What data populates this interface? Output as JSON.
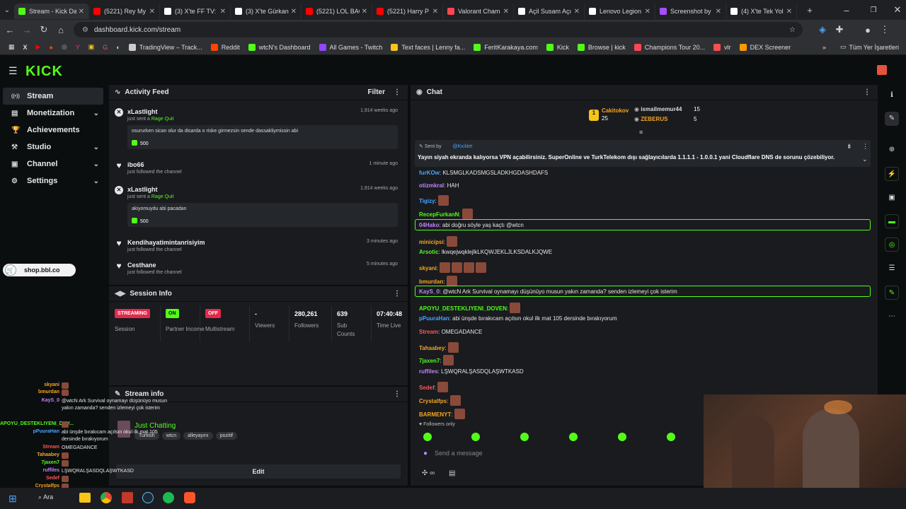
{
  "browser": {
    "tabs": [
      {
        "label": "Stream - Kick Das",
        "color": "#53fc18",
        "active": true
      },
      {
        "label": "(5221) Rey My",
        "color": "#ff0000"
      },
      {
        "label": "(3) X'te FF TV:",
        "color": "#ffffff"
      },
      {
        "label": "(3) X'te Gürkan",
        "color": "#ffffff"
      },
      {
        "label": "(5221) LOL BAC",
        "color": "#ff0000"
      },
      {
        "label": "(5221) Harry P",
        "color": "#ff0000"
      },
      {
        "label": "Valorant Cham",
        "color": "#ff4655"
      },
      {
        "label": "Açil Susam Açı",
        "color": "#ffffff"
      },
      {
        "label": "Lenovo Legion",
        "color": "#ffffff"
      },
      {
        "label": "Screenshot by",
        "color": "#a64dff"
      },
      {
        "label": "(4) X'te Tek Yol",
        "color": "#ffffff"
      }
    ],
    "url": "dashboard.kick.com/stream",
    "bookmarks": [
      "TradingView – Track...",
      "Reddit",
      "wtcN's Dashboard",
      "All Games - Twitch",
      "Text faces | Lenny fa...",
      "FeritKarakaya.com",
      "Kick",
      "Browse | kick",
      "Champions Tour 20...",
      "vlr",
      "DEX Screener"
    ],
    "all_bookmarks": "Tüm Yer İşaretleri"
  },
  "app": {
    "logo": "KICK",
    "sidebar": [
      {
        "label": "Stream",
        "icon": "radio-icon",
        "active": true,
        "expand": false
      },
      {
        "label": "Monetization",
        "icon": "money-icon",
        "expand": true
      },
      {
        "label": "Achievements",
        "icon": "trophy-icon",
        "expand": false
      },
      {
        "label": "Studio",
        "icon": "studio-icon",
        "expand": true
      },
      {
        "label": "Channel",
        "icon": "channel-icon",
        "expand": true
      },
      {
        "label": "Settings",
        "icon": "gear-icon",
        "expand": true
      }
    ],
    "shop_link": "shop.bbl.co"
  },
  "activity_feed": {
    "title": "Activity Feed",
    "filter": "Filter",
    "items": [
      {
        "name": "xLastlight",
        "action": "just sent a",
        "tag": "Rage Quit",
        "time": "1,914 weeks ago",
        "message": "osururken sican olur da disarda o riske girmezsin sende dassakliymissin abi",
        "amount": "500",
        "icon": "x"
      },
      {
        "name": "ibo66",
        "action": "just followed the channel",
        "time": "1 minute ago",
        "icon": "heart"
      },
      {
        "name": "xLastlight",
        "action": "just sent a",
        "tag": "Rage Quit",
        "time": "1,914 weeks ago",
        "message": "akiyomuydu abi pacadan",
        "amount": "500",
        "icon": "x"
      },
      {
        "name": "Kendihayatimintanrisiyim",
        "action": "just followed the channel",
        "time": "3 minutes ago",
        "icon": "heart"
      },
      {
        "name": "Cesthane",
        "action": "just followed the channel",
        "time": "5 minutes ago",
        "icon": "heart"
      }
    ]
  },
  "session": {
    "title": "Session Info",
    "stats": [
      {
        "badge": "STREAMING",
        "label": "Session",
        "color": "#e5294b"
      },
      {
        "badge": "ON",
        "label": "Partner Income",
        "color": "#53fc18"
      },
      {
        "badge": "OFF",
        "label": "Multistream",
        "color": "#e5294b"
      },
      {
        "value": "-",
        "label": "Viewers"
      },
      {
        "value": "280,261",
        "label": "Followers"
      },
      {
        "value": "639",
        "label": "Sub Counts"
      },
      {
        "value": "07:40:48",
        "label": "Time Live"
      }
    ]
  },
  "stream_info": {
    "title": "Stream info",
    "category": "Just Chatting",
    "tags": [
      "Turkish",
      "wtcn",
      "alleyayını",
      "pozitif"
    ],
    "edit": "Edit"
  },
  "chat": {
    "title": "Chat",
    "leaderboard": [
      {
        "name": "Cakitokov",
        "count": "25"
      },
      {
        "name": "ismailmemur44",
        "count": "15"
      },
      {
        "name": "ZEBERUS",
        "count": "5"
      }
    ],
    "pinned": {
      "sent_by": "Sent by",
      "user": "@Kicklet",
      "text": "Yayın siyah ekranda kalıyorsa VPN açabilirsiniz. SuperOnline ve TurkTelekom dışı sağlayıcılarda 1.1.1.1 - 1.0.0.1 yani Cloudflare DNS de sorunu çözebiliyor."
    },
    "messages": [
      {
        "user": "furKOw",
        "color": "#4aa3ff",
        "text": "KLSMGLKADSMGSLADKHGDASHDAFS"
      },
      {
        "user": "otizmkral",
        "color": "#c084fc",
        "text": "HAH"
      },
      {
        "user": "Tigizy",
        "color": "#4aa3ff",
        "text": "",
        "emotes": 1
      },
      {
        "user": "RecepFurkanN",
        "color": "#53fc18",
        "text": "",
        "emotes": 1
      },
      {
        "user": "04Hako",
        "color": "#c084fc",
        "text": "abi doğru söyle yaş kaçtı @wtcn",
        "hl": true
      },
      {
        "user": "minicipsi",
        "color": "#f5a623",
        "text": "",
        "emotes": 1
      },
      {
        "user": "Arsotic",
        "color": "#53fc18",
        "text": "lkwqejwqklejlkLKQWJEKLJLKSDALKJQWE"
      },
      {
        "user": "skyani",
        "color": "#f5a623",
        "text": "",
        "emotes": 4
      },
      {
        "user": "bmurdan",
        "color": "#f5a623",
        "text": "",
        "emotes": 1
      },
      {
        "user": "KayS_0",
        "color": "#c084fc",
        "text": "@wtcN Ark Survival oynamayı düşünüyo musun yakın zamanda? senden izlemeyi çok isterim",
        "hl": true
      },
      {
        "user": "APOYU_DESTEKLIYENI_DOVEN",
        "color": "#53fc18",
        "text": "",
        "emotes": 1
      },
      {
        "user": "pPuuraHan",
        "color": "#4aa3ff",
        "text": "abi ünşde bırakıcam açılsın okul ilk mat 105 dersinde bırakıyorum"
      },
      {
        "user": "Stream",
        "color": "#ff5555",
        "text": "OMEGADANCE"
      },
      {
        "user": "Tahaabey",
        "color": "#f5a623",
        "text": "",
        "emotes": 1
      },
      {
        "user": "7jaxen7",
        "color": "#53fc18",
        "text": "",
        "emotes": 1
      },
      {
        "user": "ruffiles",
        "color": "#c084fc",
        "text": "LŞWQRALŞASDQLAŞWTKASD"
      },
      {
        "user": "Sedef",
        "color": "#ff5555",
        "text": "",
        "emotes": 1
      },
      {
        "user": "Crystalfps",
        "color": "#f5a623",
        "text": "",
        "emotes": 1
      },
      {
        "user": "BARMENYT",
        "color": "#f5a623",
        "text": "",
        "emotes": 1
      }
    ],
    "followers_only": "Followers only",
    "input_placeholder": "Send a message"
  },
  "overlay_chat": [
    {
      "user": "skyani",
      "color": "#f5a623",
      "text": ""
    },
    {
      "user": "bmurdan",
      "color": "#f5a623",
      "text": ""
    },
    {
      "user": "KayS_0",
      "color": "#c084fc",
      "text": "@wtcN Ark Survival oynamayı düşünüyo musun yakın zamanda? senden izlemeyi çok isterim"
    },
    {
      "user": "APOYU_DESTEKLIYENI_DOV...",
      "color": "#53fc18",
      "text": ""
    },
    {
      "user": "pPuuraHan",
      "color": "#4aa3ff",
      "text": "abi ünşde bırakıcam açılsın okul ilk mat 105 dersinde bırakıyorum"
    },
    {
      "user": "Stream",
      "color": "#ff5555",
      "text": "OMEGADANCE"
    },
    {
      "user": "Tahaabey",
      "color": "#f5a623",
      "text": ""
    },
    {
      "user": "7jaxen7",
      "color": "#53fc18",
      "text": ""
    },
    {
      "user": "ruffiles",
      "color": "#c084fc",
      "text": "LŞWQRALŞASDQLAŞWTKASD"
    },
    {
      "user": "Sedef",
      "color": "#ff5555",
      "text": ""
    },
    {
      "user": "Crystalfps",
      "color": "#f5a623",
      "text": ""
    },
    {
      "user": "BARMENYT",
      "color": "#f5a623",
      "text": ""
    }
  ],
  "taskbar": {
    "search": "Ara"
  }
}
